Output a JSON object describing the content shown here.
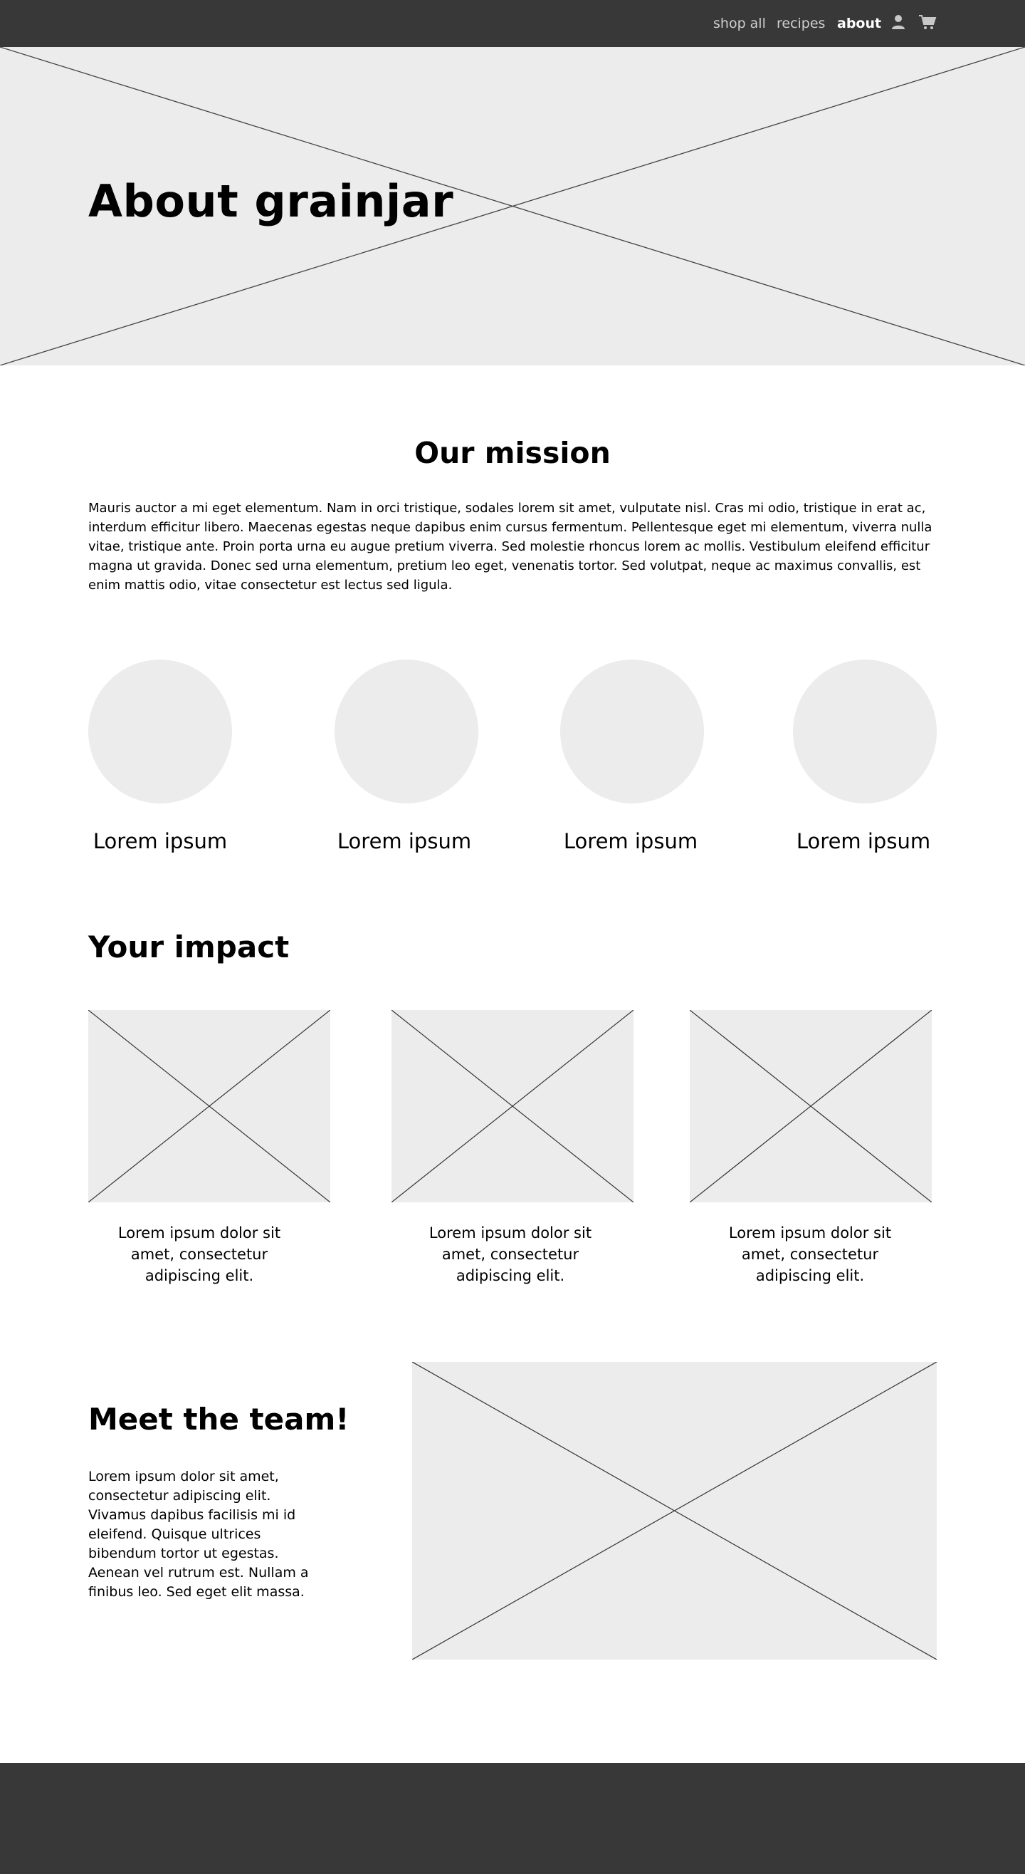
{
  "nav": {
    "links": [
      {
        "label": "shop all"
      },
      {
        "label": "recipes"
      },
      {
        "label": "about"
      }
    ],
    "account_icon": "user-icon",
    "cart_icon": "cart-icon",
    "background_color": "#383838",
    "active_color": "#ffffff",
    "link_color": "#cfcfcf"
  },
  "hero": {
    "title": "About grainjar",
    "image": "image-placeholder"
  },
  "mission": {
    "title": "Our mission",
    "text": "Mauris auctor a mi eget elementum. Nam in orci tristique, sodales lorem sit amet, vulputate nisl. Cras mi odio, tristique in erat ac, interdum efficitur libero. Maecenas egestas neque dapibus enim cursus fermentum. Pellentesque eget mi elementum, viverra nulla vitae, tristique ante. Proin porta urna eu augue pretium viverra. Sed molestie rhoncus lorem ac mollis. Vestibulum eleifend efficitur magna ut gravida. Donec sed urna elementum, pretium leo eget, venenatis tortor. Sed volutpat, neque ac maximus convallis, est enim mattis odio, vitae consectetur est lectus sed ligula."
  },
  "values": [
    {
      "label": "Lorem ipsum"
    },
    {
      "label": "Lorem ipsum"
    },
    {
      "label": "Lorem ipsum"
    },
    {
      "label": "Lorem ipsum"
    }
  ],
  "impact": {
    "title": "Your impact",
    "items": [
      {
        "caption": "Lorem ipsum dolor sit amet, consectetur adipiscing elit."
      },
      {
        "caption": "Lorem ipsum dolor sit amet, consectetur adipiscing elit."
      },
      {
        "caption": "Lorem ipsum dolor sit amet, consectetur adipiscing elit."
      }
    ]
  },
  "team": {
    "title": "Meet the team!",
    "text": "Lorem ipsum dolor sit amet, consectetur adipiscing elit. Vivamus dapibus facilisis mi id eleifend. Quisque ultrices bibendum tortor ut egestas. Aenean vel rutrum est. Nullam a finibus leo. Sed eget elit massa."
  },
  "colors": {
    "placeholder": "#ececec",
    "footer": "#383838"
  }
}
